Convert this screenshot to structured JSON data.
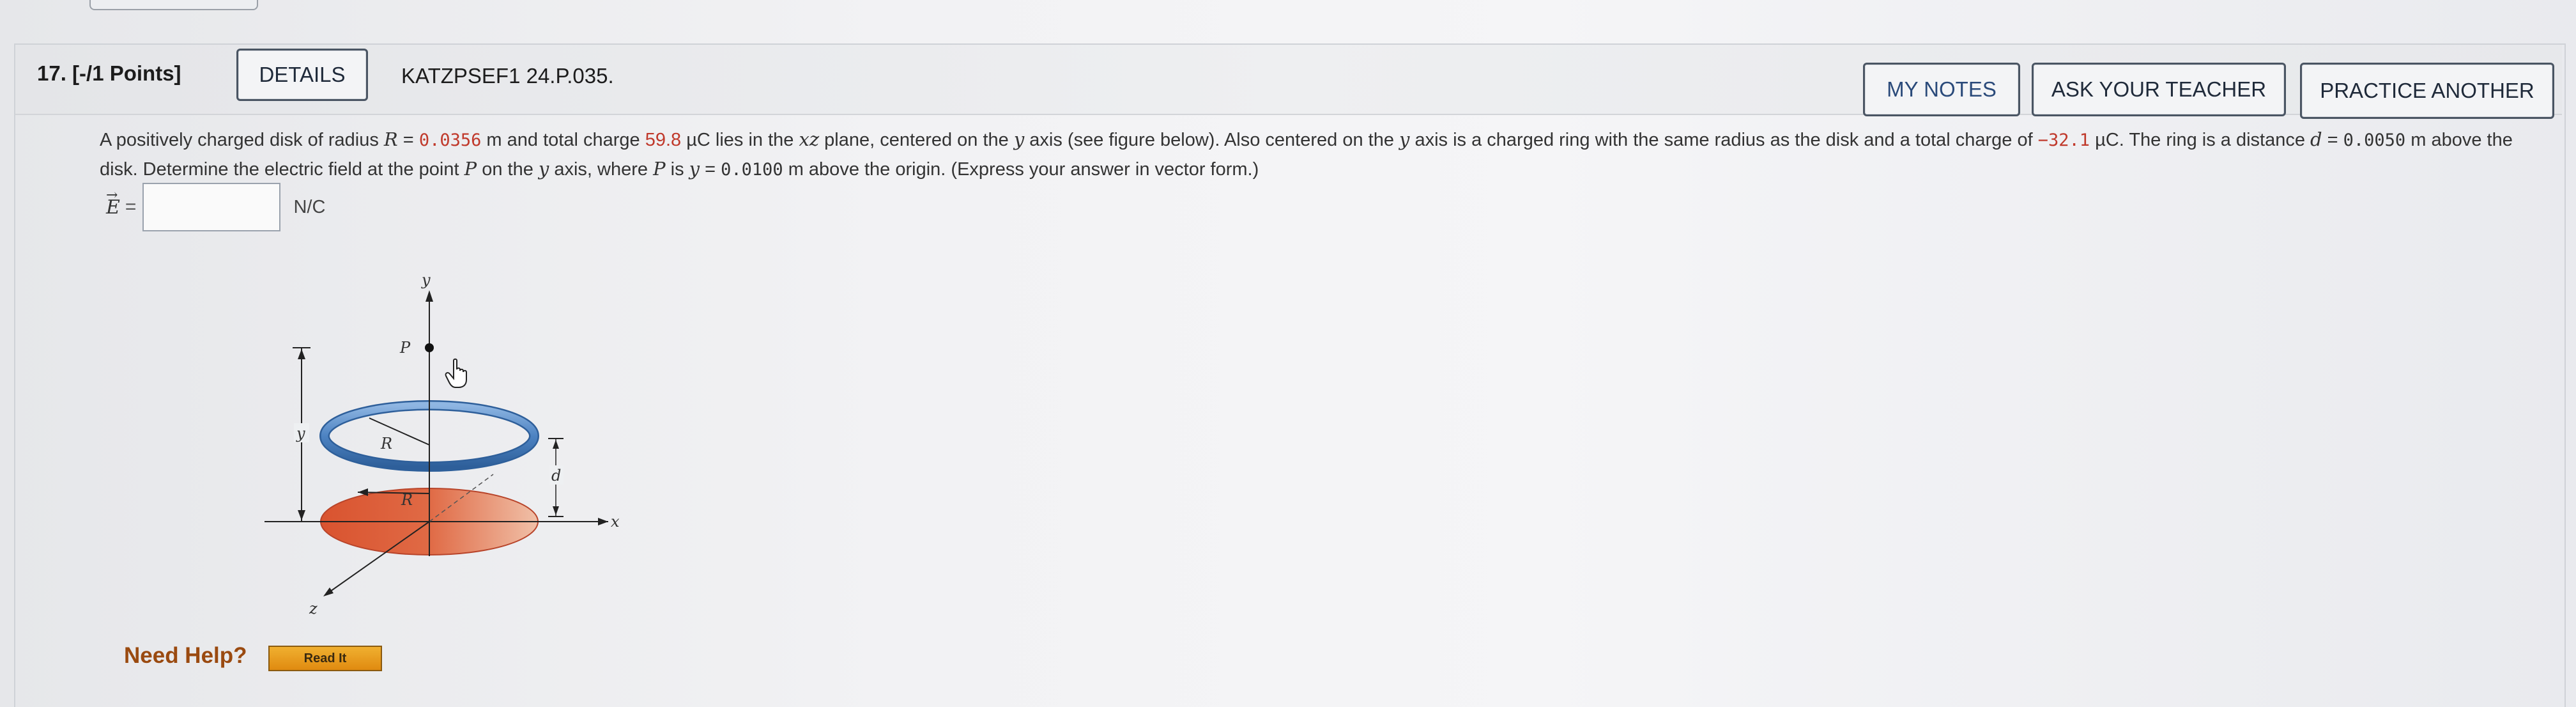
{
  "question": {
    "number_label": "17.  [-/1 Points]",
    "details_label": "DETAILS",
    "code": "KATZPSEF1 24.P.035."
  },
  "actions": {
    "my_notes": "MY NOTES",
    "ask_teacher": "ASK YOUR TEACHER",
    "practice_another": "PRACTICE ANOTHER"
  },
  "problem": {
    "t1": "A positively charged disk of radius ",
    "R_sym": "R",
    "eq1": " = ",
    "R_val": "0.0356",
    "R_unit": " m  and total charge ",
    "Q_val": "59.8",
    "Q_unit": " µC lies in the ",
    "xz": "xz",
    "t2": " plane, centered on the ",
    "y1": "y",
    "t3": " axis (see figure below). Also centered on the ",
    "y2": "y",
    "t4": " axis is a charged ring with the same radius as the disk and a total charge of ",
    "q_val": "−32.1",
    "q_unit": "  µC. The ring is a distance  ",
    "d_sym": "d",
    "eq2": " = ",
    "d_val": "0.0050",
    "d_unit": " m  above the disk. Determine the electric field at the point ",
    "P_sym": "P",
    "t5": " on the ",
    "y3": "y",
    "t6": " axis, where ",
    "P_sym2": "P",
    "t7": " is  ",
    "y4": "y",
    "eq3": " = ",
    "y_val": "0.0100",
    "y_unit": " m  above the origin. (Express your answer in vector form.)"
  },
  "answer": {
    "label": "E",
    "arrow": "→",
    "equals": "=",
    "value": "",
    "unit": "N/C"
  },
  "figure": {
    "axis_y": "y",
    "axis_x": "x",
    "axis_z": "z",
    "point_p": "P",
    "ring_r": "R",
    "disk_r": "R",
    "dim_y": "y",
    "dim_d": "d",
    "ring_color": "#5b8fc9",
    "disk_color": "#d9623f"
  },
  "help": {
    "need_help": "Need Help?",
    "read_it": "Read It"
  }
}
